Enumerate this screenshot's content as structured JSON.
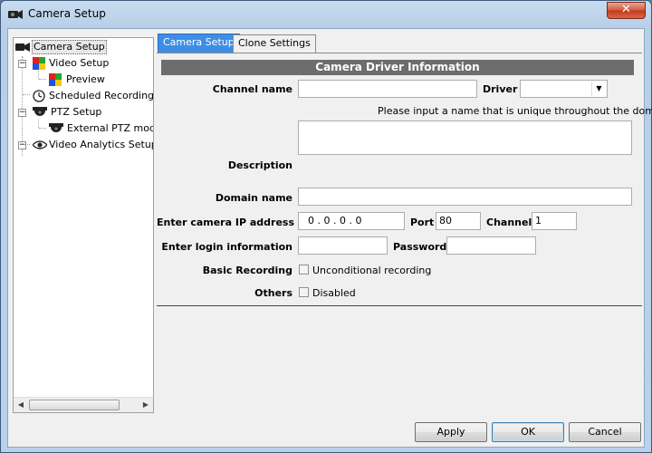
{
  "window": {
    "title": "Camera Setup",
    "close_label": "✕"
  },
  "tree": {
    "items": [
      {
        "label": "Camera Setup"
      },
      {
        "label": "Video Setup"
      },
      {
        "label": "Preview"
      },
      {
        "label": "Scheduled Recording S"
      },
      {
        "label": "PTZ Setup"
      },
      {
        "label": "External PTZ mod"
      },
      {
        "label": "Video Analytics Setup"
      }
    ],
    "expanders": [
      "−",
      "−",
      "−"
    ]
  },
  "tabs": [
    {
      "label": "Camera Setup",
      "active": true
    },
    {
      "label": "Clone Settings",
      "active": false
    }
  ],
  "form": {
    "section_title": "Camera Driver Information",
    "channel_name": {
      "label": "Channel name",
      "value": ""
    },
    "driver": {
      "label": "Driver",
      "value": ""
    },
    "hint": "Please input a name that is unique throughout the domain.",
    "description": {
      "label": "Description",
      "value": ""
    },
    "domain_name": {
      "label": "Domain name",
      "value": ""
    },
    "ip": {
      "label": "Enter camera IP address",
      "value": "0  .  0  .  0  .  0"
    },
    "port": {
      "label": "Port",
      "value": "80"
    },
    "channel": {
      "label": "Channel",
      "value": "1"
    },
    "login": {
      "label": "Enter login information",
      "value": ""
    },
    "password": {
      "label": "Password",
      "value": ""
    },
    "basic_recording": {
      "label": "Basic Recording",
      "option": "Unconditional recording",
      "checked": false
    },
    "others": {
      "label": "Others",
      "option": "Disabled",
      "checked": false
    }
  },
  "buttons": {
    "apply": "Apply",
    "ok": "OK",
    "cancel": "Cancel"
  },
  "scroll": {
    "left": "◀",
    "right": "▶"
  },
  "colors": {
    "accent": "#3d8ee6",
    "header": "#6d6d6d"
  }
}
